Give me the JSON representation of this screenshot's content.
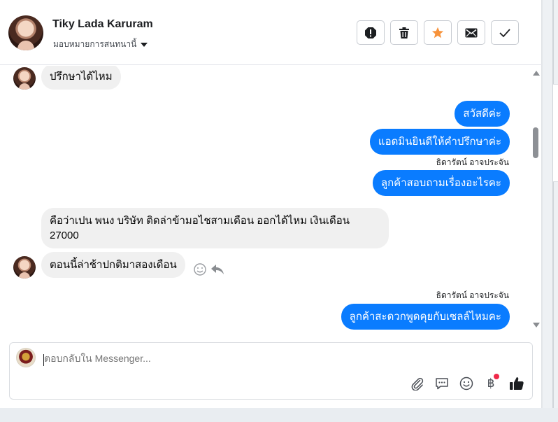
{
  "header": {
    "contact_name": "Tiky Lada Karuram",
    "assign_label": "มอบหมายการสนทนานี้",
    "actions": [
      "spam-alert",
      "delete",
      "star",
      "mark-unread",
      "mark-done"
    ],
    "star_color": "#f7923a"
  },
  "messages": {
    "m1": "ปรึกษาได้ไหม",
    "m2": "สวัสดีค่ะ",
    "m3": "แอดมินยินดีให้คำปรึกษาค่ะ",
    "sender1": "ธิดารัตน์ อาจประจัน",
    "m4": "ลูกค้าสอบถามเรื่องอะไรคะ",
    "m5": "คือว่าเปน พนง บริษัท ติดล่าข้ามอไชสามเดือน ออกได้ไหม เงินเดือน 27000",
    "m6": "ตอนนี้ล่าช้าปกติมาสองเดือน",
    "sender2": "ธิดารัตน์ อาจประจัน",
    "m7": "ลูกค้าสะดวกพูดคุยกับเซลล์ไหมคะ"
  },
  "composer": {
    "placeholder": "ตอบกลับใน Messenger...",
    "currency_symbol": "฿",
    "tools": [
      "attach-icon",
      "saved-reply-icon",
      "emoji-icon",
      "payment-icon",
      "thumbs-up-icon"
    ]
  },
  "colors": {
    "outgoing_bubble": "#0a7cff",
    "incoming_bubble": "#f0f0f0"
  }
}
